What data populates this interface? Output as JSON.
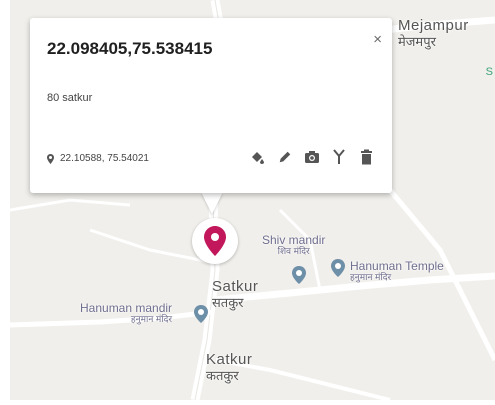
{
  "popup": {
    "title": "22.098405,75.538415",
    "description": "80 satkur",
    "coords": "22.10588, 75.54021",
    "close_label": "×"
  },
  "places": {
    "mejampur_en": "Mejampur",
    "mejampur_hi": "मेजमपुर",
    "shiv_en": "Shiv mandir",
    "shiv_hi": "शिव मंदिर",
    "hanuman_temple_en": "Hanuman Temple",
    "hanuman_temple_hi": "हनुमान मंदिर",
    "satkur_en": "Satkur",
    "satkur_hi": "सतकुर",
    "hanuman_mandir_en": "Hanuman mandir",
    "hanuman_mandir_hi": "हनुमान मंदिर",
    "katkur_en": "Katkur",
    "katkur_hi": "कतकुर",
    "edge_letter": "S"
  },
  "colors": {
    "marker": "#c2185b",
    "poi_pin": "#6e8fa8",
    "tool_icon": "#555555"
  },
  "icons": [
    "paint-bucket-icon",
    "pencil-icon",
    "camera-icon",
    "route-icon",
    "trash-icon",
    "location-pin-icon",
    "close-icon"
  ]
}
